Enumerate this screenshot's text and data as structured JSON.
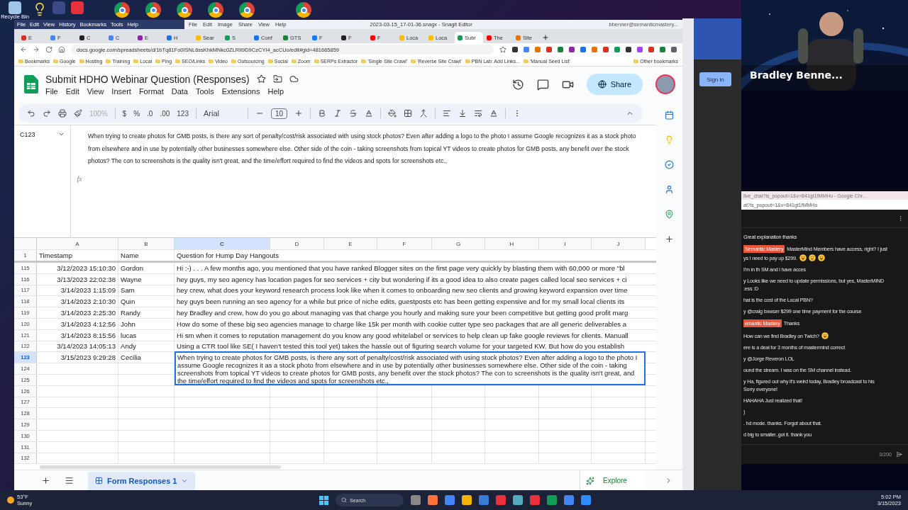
{
  "desktop": {
    "icons": [
      {
        "label": "Recycle Bin"
      }
    ],
    "app_menu": [
      "File",
      "Edit",
      "View",
      "History",
      "Bookmarks",
      "Tools",
      "Help"
    ]
  },
  "snagit": {
    "menu": [
      "File",
      "Edit",
      "Image",
      "Share",
      "View",
      "Help"
    ],
    "title": "2023-03-15_17-01-36.snagx - Snagit Editor",
    "account": "bbenner@semanticmastery..."
  },
  "browser": {
    "tabs": [
      {
        "label": "E",
        "color": "#d93025",
        "selected": false
      },
      {
        "label": "F",
        "color": "#4285f4",
        "selected": false
      },
      {
        "label": "C",
        "color": "#202124",
        "selected": false
      },
      {
        "label": "C",
        "color": "#4285f4",
        "selected": false
      },
      {
        "label": "E",
        "color": "#8e24aa",
        "selected": false
      },
      {
        "label": "H",
        "color": "#1a73e8",
        "selected": false
      },
      {
        "label": "Sear",
        "color": "#fbbc04",
        "selected": false
      },
      {
        "label": "S",
        "color": "#0f9d58",
        "selected": false
      },
      {
        "label": "Conf",
        "color": "#1a73e8",
        "selected": false
      },
      {
        "label": "GTS",
        "color": "#188038",
        "selected": false
      },
      {
        "label": "F",
        "color": "#1877f2",
        "selected": false
      },
      {
        "label": "F",
        "color": "#202124",
        "selected": false
      },
      {
        "label": "F",
        "color": "#ff0000",
        "selected": false
      },
      {
        "label": "Loca",
        "color": "#fbbc04",
        "selected": false
      },
      {
        "label": "Loca",
        "color": "#fbbc04",
        "selected": false
      },
      {
        "label": "Subr",
        "color": "#0f9d58",
        "selected": true
      },
      {
        "label": "The",
        "color": "#ff0000",
        "selected": false
      },
      {
        "label": "Site",
        "color": "#e8710a",
        "selected": false
      }
    ],
    "url": "docs.google.com/spreadsheets/d/1bTq81Fo0ISNL6ssKhkMNkc0ZLRlI9D9CzCYI4_acCUo/edit#gid=481665859",
    "bookmarks": [
      "Bookmarks",
      "Google",
      "Hosting",
      "Training",
      "Local",
      "Ping",
      "SEO/Links",
      "Video",
      "Outsourcing",
      "Social",
      "Zoom",
      "SERPs Extractor",
      "'Single Site Crawl'",
      "'Reverse Site Crawl'",
      "PBN Lab: Add Links...",
      "'Manual Seed List'"
    ],
    "other_bookmarks": "Other bookmarks"
  },
  "sheet": {
    "title": "Submit HDHO Webinar Question (Responses)",
    "menu": [
      "File",
      "Edit",
      "View",
      "Insert",
      "Format",
      "Data",
      "Tools",
      "Extensions",
      "Help"
    ],
    "share": "Share",
    "toolbar": {
      "zoom": "100%",
      "formats": [
        "$",
        "%",
        ".0",
        ".00",
        "123"
      ],
      "font": "Arial",
      "font_size": "10"
    },
    "name_box": "C123",
    "fx_label": "fx",
    "formula": "When trying to create photos for GMB posts, is there any sort of penalty/cost/risk associated with using stock photos? Even after adding a logo to the photo I assume Google recognizes it as a stock photo from elsewhere and in use by potentially other businesses somewhere else. Other side of the coin - taking screenshots from topical YT videos to create photos for GMB posts, any benefit over the stock photos? The con to screenshots is the quality isn't great, and the time/effort required to find the videos and spots for screenshots etc.,",
    "columns": [
      {
        "label": "A",
        "selected": false
      },
      {
        "label": "B",
        "selected": false
      },
      {
        "label": "C",
        "selected": true
      },
      {
        "label": "D",
        "selected": false
      },
      {
        "label": "E",
        "selected": false
      },
      {
        "label": "F",
        "selected": false
      },
      {
        "label": "G",
        "selected": false
      },
      {
        "label": "H",
        "selected": false
      },
      {
        "label": "I",
        "selected": false
      },
      {
        "label": "J",
        "selected": false
      }
    ],
    "header_row": {
      "number": "1",
      "cells": [
        "Timestamp",
        "Name",
        "Question for Hump Day Hangouts"
      ]
    },
    "rows": [
      {
        "number": "115",
        "timestamp": "3/12/2023 15:10:30",
        "name": "Gordon",
        "question": "Hi :-) . . . A few months ago, you mentioned that you have ranked Blogger sites on the first page very quickly by blasting them with 60,000 or more \"bl",
        "selected": false
      },
      {
        "number": "116",
        "timestamp": "3/13/2023 22:02:38",
        "name": "Wayne",
        "question": "hey guys, my seo agency has location pages for seo services + city but wondering if its a good idea to also create pages called local seo services + ci",
        "selected": false
      },
      {
        "number": "117",
        "timestamp": "3/14/2023 1:15:09",
        "name": "Sam",
        "question": "hey crew, what does your keyword research process look like when it comes to onboarding new seo clients and growing keyword expansion over time",
        "selected": false
      },
      {
        "number": "118",
        "timestamp": "3/14/2023 2:10:30",
        "name": "Quin",
        "question": "hey guys  been running an seo agency for a while but price of niche edits, guestposts etc has been getting expensive and for my small local clients  its",
        "selected": false
      },
      {
        "number": "119",
        "timestamp": "3/14/2023 2:25:30",
        "name": "Randy",
        "question": "hey Bradley and crew, how do you go about managing vas that charge you hourly and making sure your been competitive but getting good profit marg",
        "selected": false
      },
      {
        "number": "120",
        "timestamp": "3/14/2023 4:12:56",
        "name": "John",
        "question": "How do some of these big seo agencies manage to charge like 15k per month with cookie cutter type seo packages that are all generic deliverables a",
        "selected": false
      },
      {
        "number": "121",
        "timestamp": "3/14/2023 8:15:56",
        "name": "lucas",
        "question": "Hi sm when it comes to reputation management do you know any good whitelabel or services to help clean up fake google reviews for clients. Manuall",
        "selected": false
      },
      {
        "number": "122",
        "timestamp": "3/14/2023 14:05:13",
        "name": "Andy",
        "question": "Using a CTR tool like SE( I haven't tested this tool yet) takes the hassle out of figuring search volume for your targeted KW. But how do you establish",
        "selected": false
      },
      {
        "number": "123",
        "timestamp": "3/15/2023 9:29:28",
        "name": "Cecilia",
        "question": "When trying to create photos for GMB posts, is there any sort of penalty/cost/risk associated with using stock photos? Even after adding a logo to the photo I assume Google recognizes it as a stock photo from elsewhere and in use by potentially other businesses somewhere else. Other side of the coin - taking screenshots from topical YT videos to create photos for GMB posts, any benefit over the stock photos? The con to screenshots is the quality isn't great, and the time/effort required to find the videos and spots for screenshots etc.,",
        "selected": true
      },
      {
        "number": "124",
        "selected": false
      },
      {
        "number": "125",
        "selected": false
      },
      {
        "number": "126",
        "selected": false
      },
      {
        "number": "127",
        "selected": false
      },
      {
        "number": "128",
        "selected": false
      },
      {
        "number": "129",
        "selected": false
      },
      {
        "number": "130",
        "selected": false
      },
      {
        "number": "131",
        "selected": false
      },
      {
        "number": "132",
        "selected": false
      }
    ],
    "sheet_tab": "Form Responses 1",
    "explore": "Explore"
  },
  "side_window": {
    "button": "Sign in"
  },
  "video": {
    "name": "Bradley Benne..."
  },
  "chat": {
    "window_title": "live_chat?is_popout=1&v=841gt1fMMHo - Google Chr...",
    "url": "at?is_popout=1&v=841gt1fMMHo",
    "messages": [
      {
        "lines": [
          "Great explanation thanks"
        ]
      },
      {
        "badge": "Semantic Mastery",
        "lines": [
          "MasterMind Members have access, right? I just",
          "ys I need to pay up $299."
        ],
        "emojis": [
          {
            "kind": "rofl"
          },
          {
            "kind": "grin"
          },
          {
            "kind": "rofl"
          }
        ]
      },
      {
        "lines": [
          "I'm in th SM and i have acces"
        ]
      },
      {
        "lines": [
          "y  Looks like we need to update permissions, but yes, MasterMIND",
          ":ess :D"
        ]
      },
      {
        "lines": [
          "hat is the cost of the Local PBN?"
        ]
      },
      {
        "lines": [
          "y  @craig bowser $299 one time payment for the course"
        ]
      },
      {
        "badge": "emantic Mastery",
        "lines": [
          "Thanks"
        ]
      },
      {
        "lines": [
          "How can we find Bradley on Twich?"
        ],
        "emojis": [
          {
            "kind": "rofl"
          }
        ]
      },
      {
        "lines": [
          "ere is a deal for 3 months of mastermind correct"
        ]
      },
      {
        "lines": [
          "y  @Jorge Reveron LOL"
        ]
      },
      {
        "lines": [
          "ound the stream. I was on the SM channel instead."
        ]
      },
      {
        "lines": [
          "y  Ha, figured out why it's weird today, Bradley broadcast to his",
          "Sorry everyone!"
        ]
      },
      {
        "lines": [
          "HAHAHA Just realized that!"
        ]
      },
      {
        "lines": [
          ")"
        ]
      },
      {
        "lines": [
          ". hd mode. thanks. Forgot about that."
        ]
      },
      {
        "lines": [
          "d big to smaller..got it. thank you"
        ]
      }
    ],
    "counter": "0/200"
  },
  "taskbar": {
    "temperature": "53°F",
    "weather": "Sunny",
    "search": "Search",
    "time": "5:02 PM",
    "date": "3/15/2023"
  }
}
